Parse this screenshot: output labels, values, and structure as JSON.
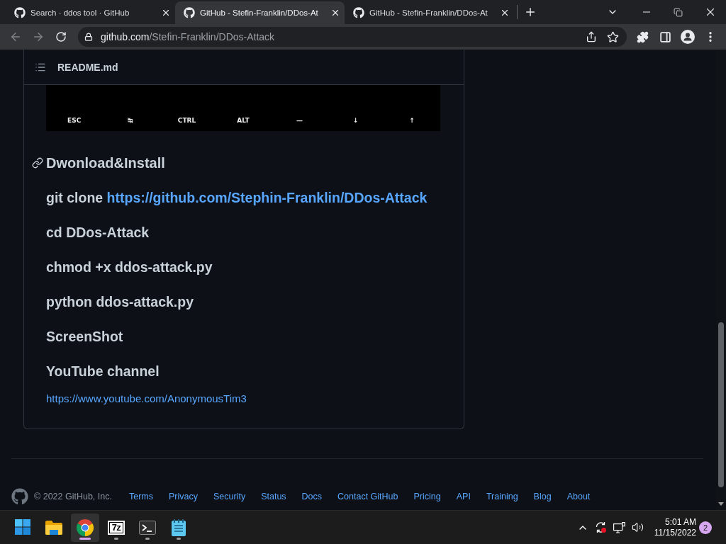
{
  "browser": {
    "tabs": [
      {
        "title": "Search · ddos tool · GitHub",
        "selected": false
      },
      {
        "title": "GitHub - Stefin-Franklin/DDos-At",
        "selected": true
      },
      {
        "title": "GitHub - Stefin-Franklin/DDos-At",
        "selected": false
      }
    ],
    "back": {
      "disabled": true
    },
    "forward": {
      "disabled": true
    },
    "address": {
      "host": "github.com",
      "path": "/Stefin-Franklin/DDos-Attack"
    }
  },
  "readme": {
    "title": "README.md",
    "keys": [
      "ESC",
      "↹",
      "CTRL",
      "ALT",
      "—",
      "↓",
      "↑"
    ],
    "heading": "Dwonload&Install",
    "lines": [
      {
        "text": "git clone",
        "link": "https://github.com/Stephin-Franklin/DDos-Attack"
      },
      {
        "text": "cd DDos-Attack"
      },
      {
        "text": "chmod +x ddos-attack.py"
      },
      {
        "text": "python ddos-attack.py"
      },
      {
        "text": "ScreenShot"
      },
      {
        "text": "YouTube channel"
      }
    ],
    "channel_link": "https://www.youtube.com/AnonymousTim3"
  },
  "footer": {
    "copyright": "© 2022 GitHub, Inc.",
    "links": [
      "Terms",
      "Privacy",
      "Security",
      "Status",
      "Docs",
      "Contact GitHub",
      "Pricing",
      "API",
      "Training",
      "Blog",
      "About"
    ]
  },
  "taskbar": {
    "apps": [
      {
        "kind": "start",
        "running": false,
        "selected": false
      },
      {
        "kind": "files",
        "running": false,
        "selected": false
      },
      {
        "kind": "browser",
        "running": true,
        "selected": true
      },
      {
        "kind": "archiver",
        "label": "7z",
        "running": true,
        "selected": false
      },
      {
        "kind": "terminal",
        "running": true,
        "selected": false
      },
      {
        "kind": "notepad",
        "running": true,
        "selected": false
      }
    ],
    "tray": {
      "time": "5:01 AM",
      "date": "11/15/2022",
      "notifications": "2"
    }
  }
}
